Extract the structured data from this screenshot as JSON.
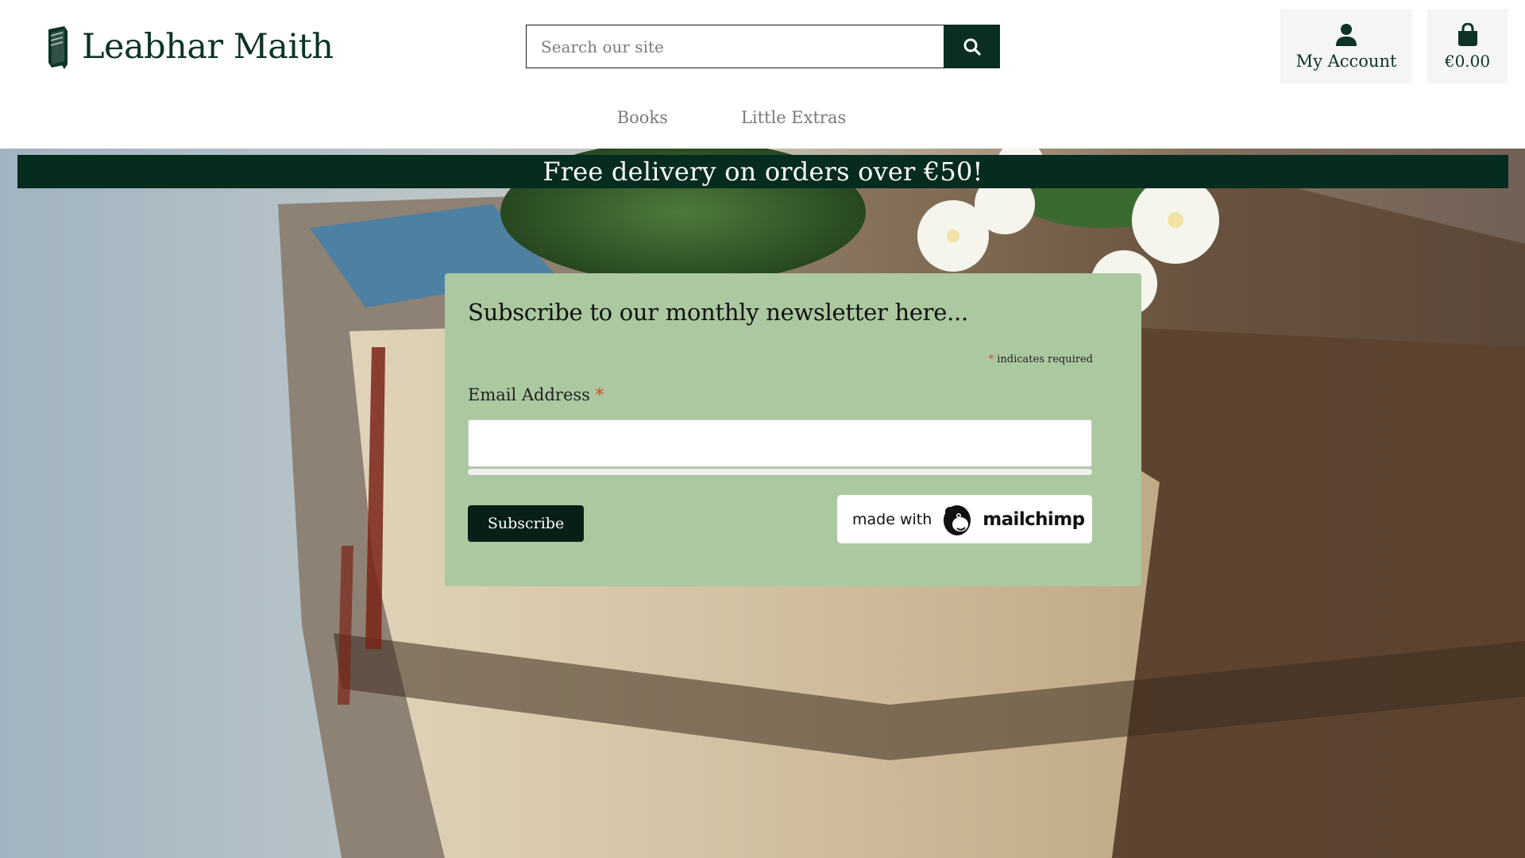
{
  "brand": {
    "name": "Leabhar Maith"
  },
  "search": {
    "placeholder": "Search our site"
  },
  "account": {
    "label": "My Account"
  },
  "cart": {
    "total": "€0.00"
  },
  "nav": {
    "items": [
      {
        "label": "Books"
      },
      {
        "label": "Little Extras"
      }
    ]
  },
  "promo": {
    "text": "Free delivery on orders over €50!"
  },
  "newsletter": {
    "title": "Subscribe to our monthly newsletter here...",
    "required_star": "*",
    "required_note": " indicates required",
    "email_label": "Email Address",
    "email_value": "",
    "subscribe_label": "Subscribe",
    "badge_made_with": "made with",
    "badge_brand": "mailchimp"
  },
  "icons": {
    "logo": "book-icon",
    "search": "magnifier-icon",
    "account": "user-icon",
    "cart": "shopping-bag-icon",
    "mailchimp": "mailchimp-monkey-icon"
  },
  "colors": {
    "brand_dark": "#0a2e22",
    "promo_bg": "#062b1f",
    "newsletter_bg": "#abc8a0",
    "required_star": "#d9402a",
    "nav_text": "#7a7a7a"
  }
}
